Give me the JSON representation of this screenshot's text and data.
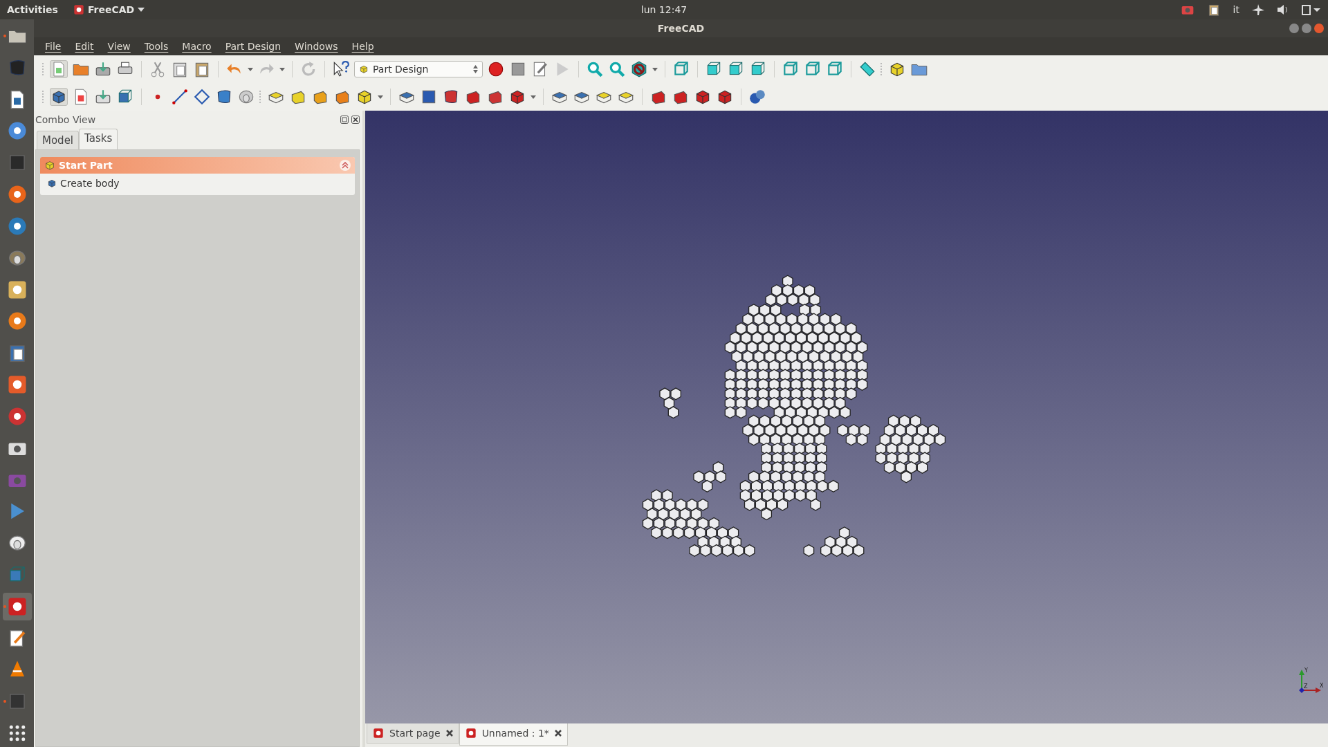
{
  "top_bar": {
    "activities": "Activities",
    "app_menu": "FreeCAD",
    "clock": "lun 12:47",
    "keyboard_layout": "it"
  },
  "dock": [
    {
      "selected": false,
      "running": true
    },
    {
      "selected": false,
      "running": false
    },
    {
      "selected": false,
      "running": false
    },
    {
      "selected": false,
      "running": false
    },
    {
      "selected": false,
      "running": false
    },
    {
      "selected": false,
      "running": false
    },
    {
      "selected": false,
      "running": false
    },
    {
      "selected": false,
      "running": false
    },
    {
      "selected": false,
      "running": false
    },
    {
      "selected": false,
      "running": false
    },
    {
      "selected": false,
      "running": false
    },
    {
      "selected": false,
      "running": false
    },
    {
      "selected": false,
      "running": false
    },
    {
      "selected": false,
      "running": false
    },
    {
      "selected": false,
      "running": false
    },
    {
      "selected": false,
      "running": false
    },
    {
      "selected": false,
      "running": false
    },
    {
      "selected": false,
      "running": false
    },
    {
      "selected": true,
      "running": true
    },
    {
      "selected": false,
      "running": false
    },
    {
      "selected": false,
      "running": false
    },
    {
      "selected": false,
      "running": true
    },
    {
      "selected": false,
      "running": false
    }
  ],
  "window": {
    "title": "FreeCAD"
  },
  "menu": [
    "File",
    "Edit",
    "View",
    "Tools",
    "Macro",
    "Part Design",
    "Windows",
    "Help"
  ],
  "workbench": {
    "value": "Part Design"
  },
  "combo_view": {
    "title": "Combo View",
    "tabs": [
      {
        "label": "Model",
        "selected": false
      },
      {
        "label": "Tasks",
        "selected": true
      }
    ],
    "task_panel": {
      "title": "Start Part",
      "expanded": true,
      "items": [
        "Create body"
      ]
    }
  },
  "axis": {
    "x": "X",
    "y": "Y",
    "z": "Z"
  },
  "document_tabs": [
    {
      "label": "Start page",
      "selected": false
    },
    {
      "label": "Unnamed : 1*",
      "selected": true
    }
  ]
}
